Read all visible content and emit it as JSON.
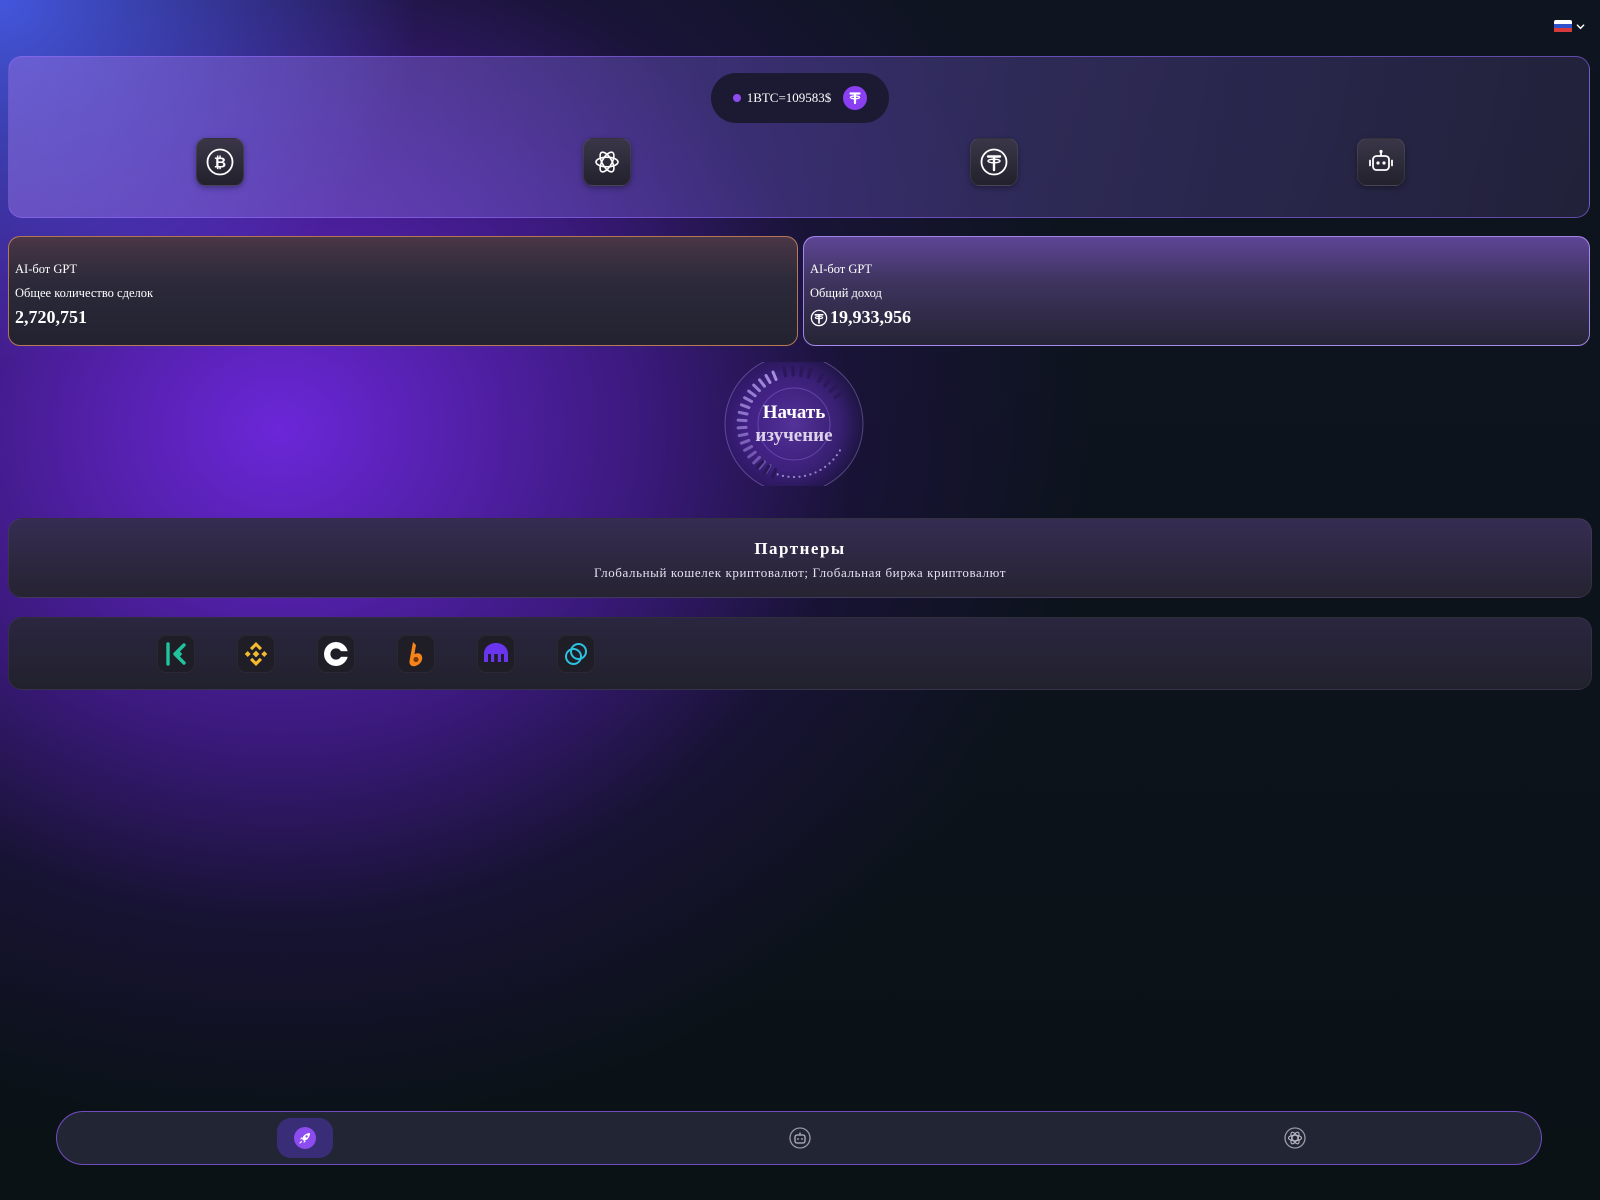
{
  "language": {
    "flag": "ru-flag",
    "flag_colors": [
      "#ffffff",
      "#2f51c9",
      "#d63a3a"
    ]
  },
  "rate": {
    "text": "1BTC=109583$",
    "icon": "tether-icon"
  },
  "feature_tiles": [
    {
      "icon": "bitcoin-icon"
    },
    {
      "icon": "openai-icon"
    },
    {
      "icon": "tether-icon"
    },
    {
      "icon": "robot-icon"
    }
  ],
  "stats": {
    "left": {
      "bot_label": "AI-бот GPT",
      "metric_label": "Общее количество сделок",
      "value": "2,720,751"
    },
    "right": {
      "bot_label": "AI-бот GPT",
      "metric_label": "Общий доход",
      "value": "19,933,956",
      "currency_icon": "tether-icon"
    }
  },
  "start_button": {
    "line1": "Начать",
    "line2": "изучение"
  },
  "partners": {
    "title": "Партнеры",
    "subtitle": "Глобальный кошелек криптовалют; Глобальная биржа криптовалют",
    "logos": [
      "kucoin-logo",
      "binance-logo",
      "coinbase-logo",
      "bitget-logo",
      "kraken-logo",
      "gemini-logo"
    ]
  },
  "bottom_nav": {
    "items": [
      {
        "icon": "rocket-icon",
        "active": true
      },
      {
        "icon": "robot-icon",
        "active": false
      },
      {
        "icon": "openai-icon",
        "active": false
      }
    ]
  },
  "colors": {
    "accent": "#8d4cf0",
    "kucoin": "#21c39e",
    "binance": "#f3ba2f",
    "coinbase": "#ffffff",
    "bitget": "#f7841a",
    "kraken": "#6b35f0",
    "gemini": "#2bc1e0"
  }
}
